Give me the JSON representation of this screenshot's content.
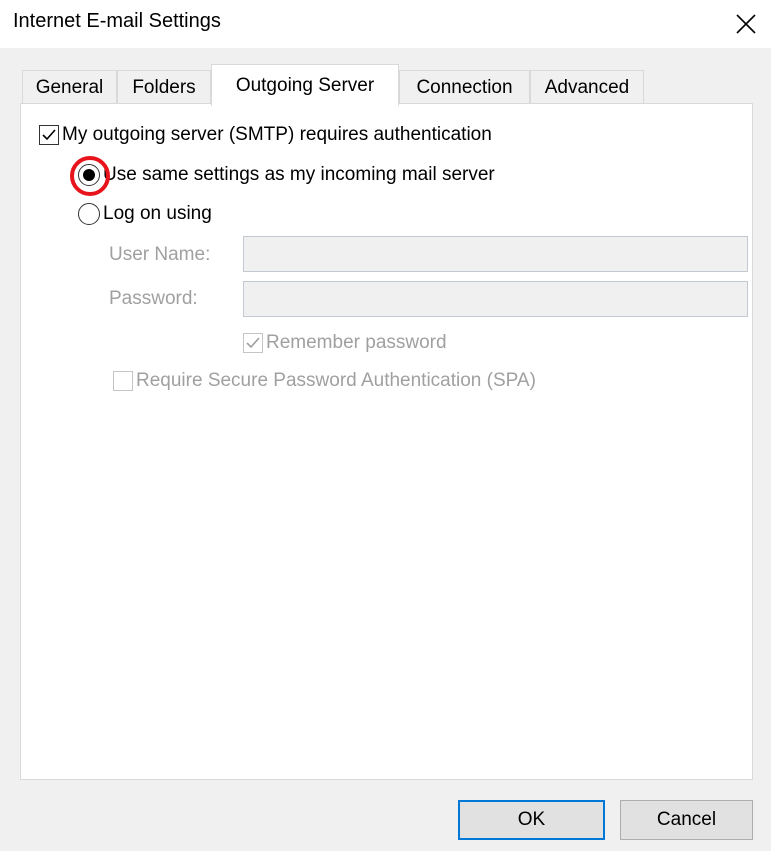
{
  "window": {
    "title": "Internet E-mail Settings",
    "close_icon": "close-icon"
  },
  "tabs": [
    {
      "label": "General",
      "active": false
    },
    {
      "label": "Folders",
      "active": false
    },
    {
      "label": "Outgoing Server",
      "active": true
    },
    {
      "label": "Connection",
      "active": false
    },
    {
      "label": "Advanced",
      "active": false
    }
  ],
  "outgoing": {
    "requires_auth": {
      "label": "My outgoing server (SMTP) requires authentication",
      "checked": true
    },
    "use_same_settings": {
      "label": "Use same settings as my incoming mail server",
      "selected": true,
      "highlighted": true
    },
    "log_on_using": {
      "label": "Log on using",
      "selected": false
    },
    "user_name": {
      "label": "User Name:",
      "value": ""
    },
    "password": {
      "label": "Password:",
      "value": ""
    },
    "remember_password": {
      "label": "Remember password",
      "checked": true,
      "enabled": false
    },
    "require_spa": {
      "label": "Require Secure Password Authentication (SPA)",
      "checked": false,
      "enabled": false
    }
  },
  "buttons": {
    "ok": "OK",
    "cancel": "Cancel"
  },
  "colors": {
    "highlight_ring": "#e8141c",
    "default_button_border": "#0078d7",
    "disabled_text": "#a0a0a0"
  }
}
